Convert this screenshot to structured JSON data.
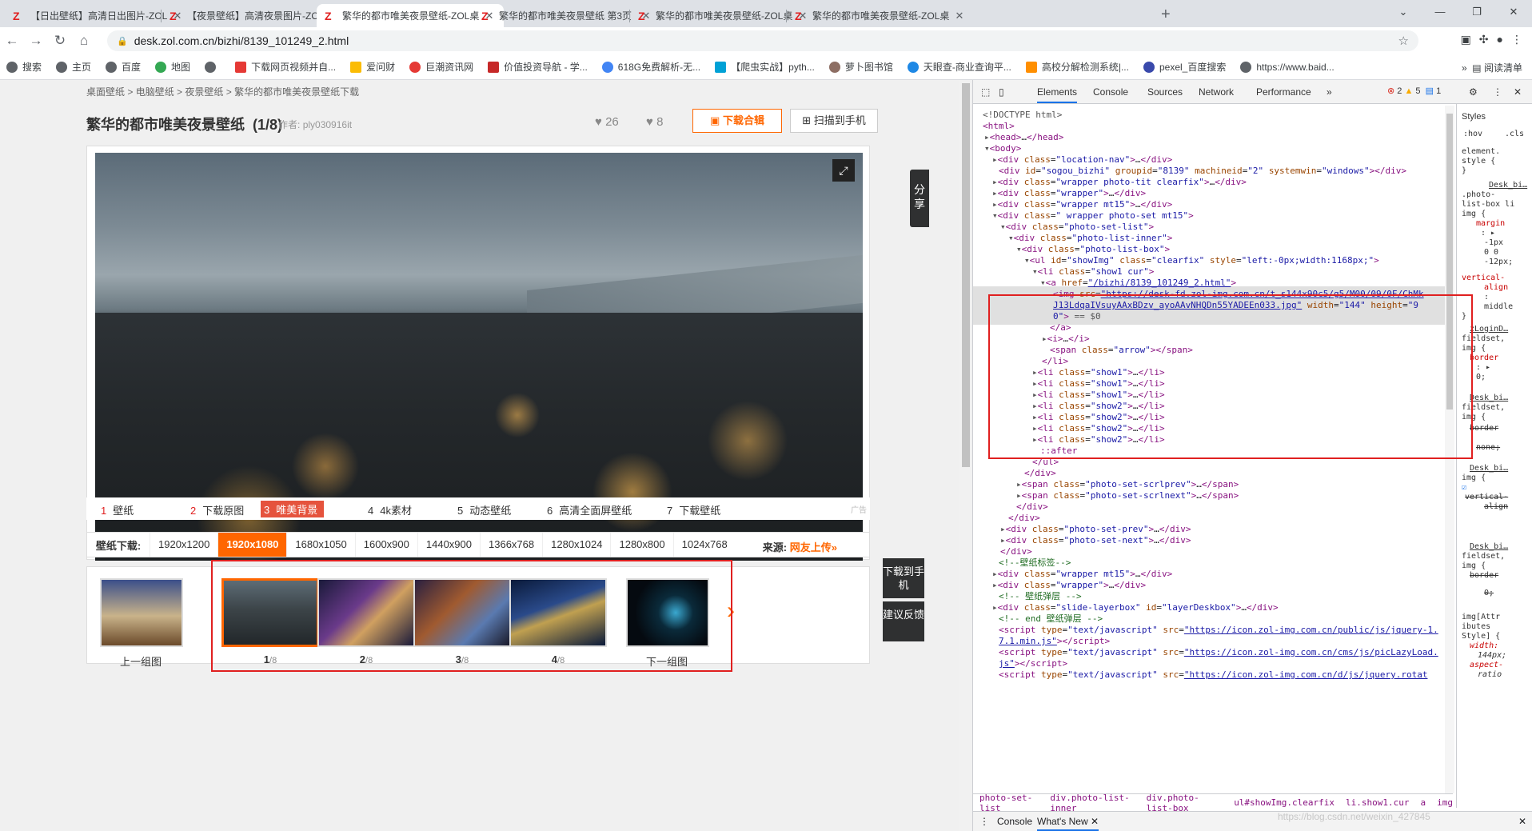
{
  "browser": {
    "tabs": [
      {
        "title": "【日出壁纸】高清日出图片-ZOL"
      },
      {
        "title": "【夜景壁纸】高清夜景图片-ZOL"
      },
      {
        "title": "繁华的都市唯美夜景壁纸-ZOL桌"
      },
      {
        "title": "繁华的都市唯美夜景壁纸 第3页"
      },
      {
        "title": "繁华的都市唯美夜景壁纸-ZOL桌"
      },
      {
        "title": "繁华的都市唯美夜景壁纸-ZOL桌"
      }
    ],
    "url": "desk.zol.com.cn/bizhi/8139_101249_2.html",
    "bookmarks": [
      "搜索",
      "主页",
      "百度",
      "地图",
      "",
      "下载网页视频并自...",
      "爱问财",
      "巨潮资讯网",
      "价值投资导航 - 学...",
      "618G免费解析-无...",
      "【爬虫实战】pyth...",
      "萝卜图书馆",
      "天眼查-商业查询平...",
      "高校分解检测系统|...",
      "pexel_百度搜索",
      "https://www.baid..."
    ],
    "reading_list": "阅读清单"
  },
  "page": {
    "breadcrumb": [
      "桌面壁纸",
      "电脑壁纸",
      "夜景壁纸",
      "繁华的都市唯美夜景壁纸下载"
    ],
    "title": "繁华的都市唯美夜景壁纸",
    "counter": "(1/8)",
    "author_label": "作者:",
    "author": "ply030916it",
    "likes": "26",
    "dislikes": "8",
    "download_all": "下载合辑",
    "scan_phone": "扫描到手机",
    "ad_links": [
      {
        "num": "1",
        "label": "壁纸"
      },
      {
        "num": "2",
        "label": "下载原图"
      },
      {
        "num": "3",
        "label": "唯美背景"
      },
      {
        "num": "4",
        "label": "4k素材"
      },
      {
        "num": "5",
        "label": "动态壁纸"
      },
      {
        "num": "6",
        "label": "高清全面屏壁纸"
      },
      {
        "num": "7",
        "label": "下载壁纸"
      }
    ],
    "ad_mark": "广告",
    "share": "分享",
    "resolution_label": "壁纸下载:",
    "resolutions": [
      "1920x1200",
      "1920x1080",
      "1680x1050",
      "1600x900",
      "1440x900",
      "1366x768",
      "1280x1024",
      "1280x800",
      "1024x768"
    ],
    "selected_resolution": "1920x1080",
    "source_label": "来源:",
    "source_value": "网友上传»",
    "prev_group": "上一组图",
    "next_group": "下一组图",
    "thumbs": [
      {
        "num": "1",
        "den": "/8"
      },
      {
        "num": "2",
        "den": "/8"
      },
      {
        "num": "3",
        "den": "/8"
      },
      {
        "num": "4",
        "den": "/8"
      }
    ],
    "side_download": "下载到手机",
    "side_feedback": "建议反馈"
  },
  "devtools": {
    "tabs": [
      "Elements",
      "Console",
      "Sources",
      "Network",
      "Performance"
    ],
    "errors": "2",
    "warnings": "5",
    "messages": "1",
    "styles_tabs": [
      "Styles",
      ":hov",
      ".cls"
    ],
    "breadcrumbs": [
      "photo-set-list",
      "div.photo-list-inner",
      "div.photo-list-box",
      "ul#showImg.clearfix",
      "li.show1.cur",
      "a",
      "img"
    ],
    "drawer_tabs": [
      "Console",
      "What's New"
    ]
  },
  "watermark": "https://blog.csdn.net/weixin_427845"
}
